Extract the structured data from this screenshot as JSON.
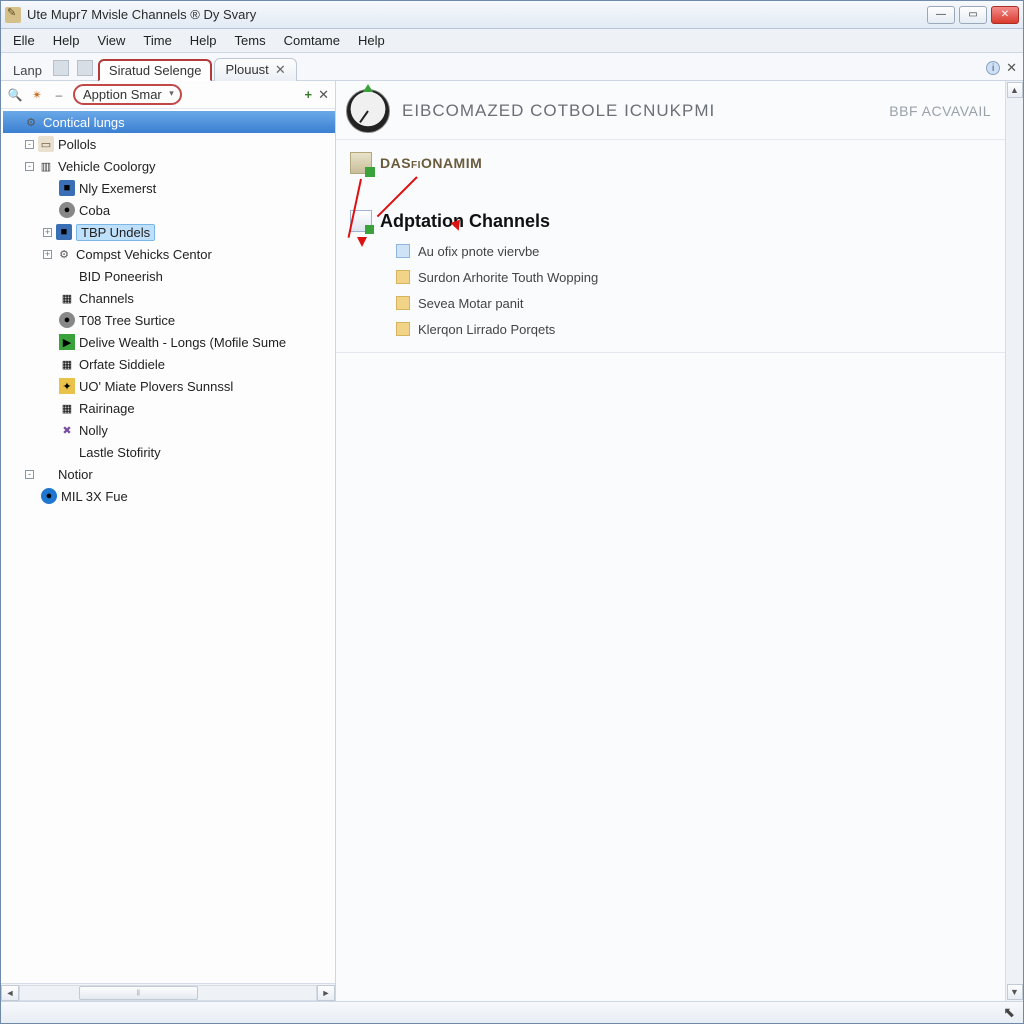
{
  "window": {
    "title": "Ute Mupr7 Mvisle Channels ® Dy Svary"
  },
  "menu": {
    "items": [
      "Elle",
      "Help",
      "View",
      "Time",
      "Help",
      "Tems",
      "Comtame",
      "Help"
    ]
  },
  "tabs": {
    "leading_label": "Lanp",
    "items": [
      {
        "label": "Siratud Selenge",
        "active": true,
        "closable": false
      },
      {
        "label": "Plouust",
        "active": false,
        "closable": true
      }
    ]
  },
  "sidebar": {
    "breadcrumb": "Apption Smar",
    "tree": [
      {
        "d": 0,
        "icon": "gear",
        "label": "Contical lungs",
        "sel": "blue",
        "tw": ""
      },
      {
        "d": 1,
        "icon": "book",
        "label": "Pollols",
        "tw": "box-"
      },
      {
        "d": 1,
        "icon": "car",
        "label": "Vehicle Coolorgy",
        "tw": "box-"
      },
      {
        "d": 2,
        "icon": "sq",
        "label": "Nly Exemerst",
        "tw": ""
      },
      {
        "d": 2,
        "icon": "ball",
        "label": "Coba",
        "tw": ""
      },
      {
        "d": 2,
        "icon": "sq",
        "label": "TBP Undels",
        "sel": "lt",
        "tw": "box+"
      },
      {
        "d": 2,
        "icon": "gear",
        "label": "Compst Vehicks Centor",
        "tw": "box+"
      },
      {
        "d": 2,
        "icon": "",
        "label": "BID Poneerish",
        "tw": ""
      },
      {
        "d": 2,
        "icon": "grid",
        "label": "Channels",
        "tw": ""
      },
      {
        "d": 2,
        "icon": "ball",
        "label": "T08 Tree Surtice",
        "tw": ""
      },
      {
        "d": 2,
        "icon": "grn",
        "label": "Delive Wealth - Longs (Mofile Sume",
        "tw": ""
      },
      {
        "d": 2,
        "icon": "grid",
        "label": "Orfate Siddiele",
        "tw": ""
      },
      {
        "d": 2,
        "icon": "yel",
        "label": "UO' Miate Plovers Sunnssl",
        "tw": ""
      },
      {
        "d": 2,
        "icon": "grid",
        "label": "Rairinage",
        "tw": ""
      },
      {
        "d": 2,
        "icon": "pur",
        "label": "Nolly",
        "tw": ""
      },
      {
        "d": 2,
        "icon": "",
        "label": "Lastle Stofirity",
        "tw": ""
      },
      {
        "d": 1,
        "icon": "",
        "label": "Notior",
        "tw": "box-"
      },
      {
        "d": 1,
        "icon": "blu",
        "label": "MIL 3X Fue",
        "tw": ""
      }
    ]
  },
  "main": {
    "header_title": "EIBCOMAZED COTBOLE ICNUKPMI",
    "header_right": "BBF ACVAVAIL",
    "section1": "DASfiONAMIM",
    "section2": "Adptation Channels",
    "items": [
      "Au ofix pnote viervbe",
      "Surdon Arhorite Touth Wopping",
      "Sevea Motar panit",
      "Klerqon Lirrado Porqets"
    ]
  },
  "icons": {
    "min": "—",
    "max": "▭",
    "close": "✕",
    "info": "i",
    "x": "✕",
    "plus": "+",
    "left": "◄",
    "right": "►",
    "up": "▲",
    "down": "▼",
    "cursor": "↖"
  }
}
